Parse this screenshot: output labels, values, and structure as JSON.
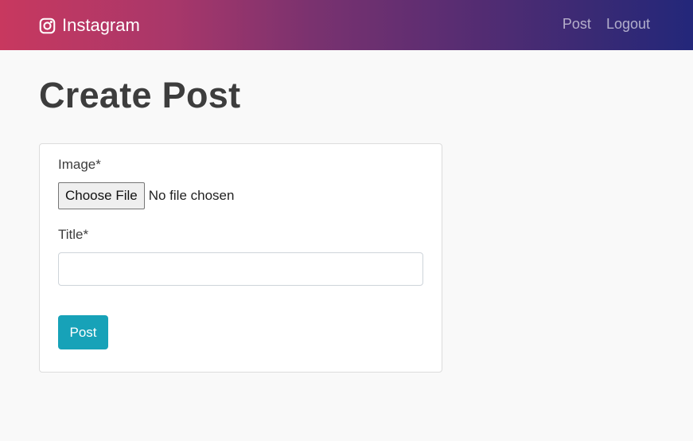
{
  "navbar": {
    "brand": {
      "icon": "instagram-icon",
      "label": "Instagram"
    },
    "links": [
      {
        "label": "Post"
      },
      {
        "label": "Logout"
      }
    ],
    "colors": {
      "gradient_start": "#c8385f",
      "gradient_end": "#23277a"
    }
  },
  "page": {
    "title": "Create Post"
  },
  "form": {
    "image_label": "Image*",
    "file_button_label": "Choose File",
    "file_status": "No file chosen",
    "title_label": "Title*",
    "title_value": "",
    "title_placeholder": "",
    "submit_label": "Post",
    "submit_color": "#17a2b8"
  }
}
